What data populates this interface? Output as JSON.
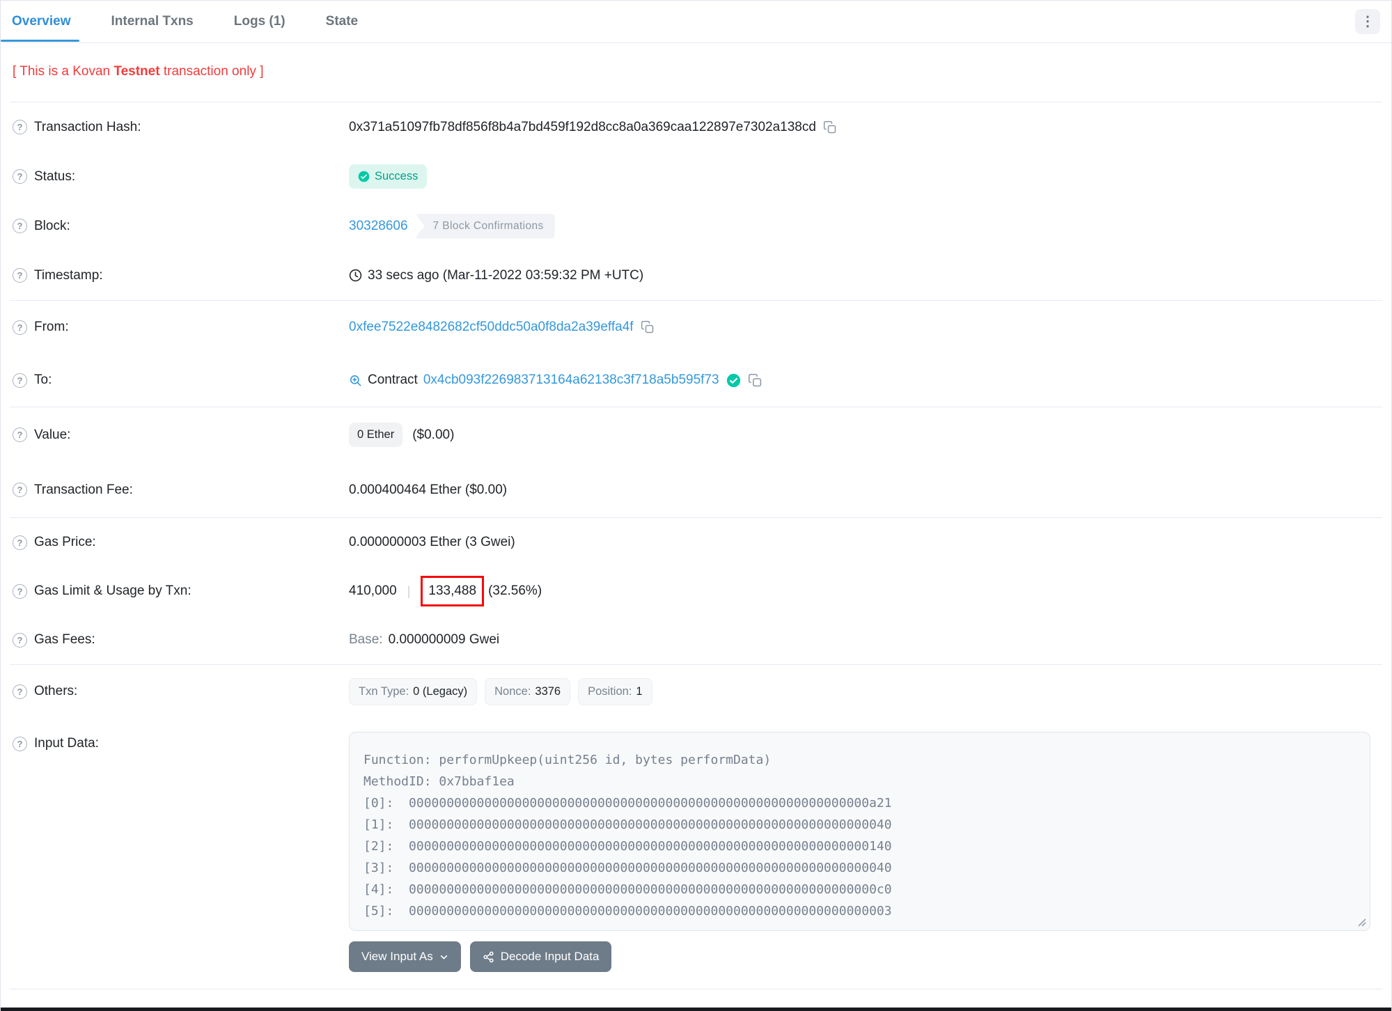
{
  "tabs": [
    {
      "label": "Overview",
      "active": true
    },
    {
      "label": "Internal Txns",
      "active": false
    },
    {
      "label": "Logs (1)",
      "active": false
    },
    {
      "label": "State",
      "active": false
    }
  ],
  "warning": {
    "prefix": "[ This is a Kovan ",
    "bold": "Testnet",
    "suffix": " transaction only ]"
  },
  "rows": {
    "transaction_hash": {
      "label": "Transaction Hash:",
      "value": "0x371a51097fb78df856f8b4a7bd459f192d8cc8a0a369caa122897e7302a138cd"
    },
    "status": {
      "label": "Status:",
      "value": "Success"
    },
    "block": {
      "label": "Block:",
      "number": "30328606",
      "confirmations": "7 Block Confirmations"
    },
    "timestamp": {
      "label": "Timestamp:",
      "value": "33 secs ago (Mar-11-2022 03:59:32 PM +UTC)"
    },
    "from": {
      "label": "From:",
      "address": "0xfee7522e8482682cf50ddc50a0f8da2a39effa4f"
    },
    "to": {
      "label": "To:",
      "contract_word": "Contract",
      "address": "0x4cb093f226983713164a62138c3f718a5b595f73"
    },
    "value": {
      "label": "Value:",
      "badge": "0 Ether",
      "usd": "($0.00)"
    },
    "transaction_fee": {
      "label": "Transaction Fee:",
      "value": "0.000400464 Ether ($0.00)"
    },
    "gas_price": {
      "label": "Gas Price:",
      "value": "0.000000003 Ether (3 Gwei)"
    },
    "gas_limit_usage": {
      "label": "Gas Limit & Usage by Txn:",
      "limit": "410,000",
      "separator": "|",
      "used": "133,488",
      "percent": "(32.56%)"
    },
    "gas_fees": {
      "label": "Gas Fees:",
      "base_label": "Base:",
      "base_value": "0.000000009 Gwei"
    },
    "others": {
      "label": "Others:",
      "badges": [
        {
          "k": "Txn Type:",
          "v": "0 (Legacy)"
        },
        {
          "k": "Nonce:",
          "v": "3376"
        },
        {
          "k": "Position:",
          "v": "1"
        }
      ]
    },
    "input_data": {
      "label": "Input Data:",
      "lines": [
        "Function: performUpkeep(uint256 id, bytes performData)",
        "",
        "MethodID: 0x7bbaf1ea",
        "[0]:  0000000000000000000000000000000000000000000000000000000000000a21",
        "[1]:  0000000000000000000000000000000000000000000000000000000000000040",
        "[2]:  0000000000000000000000000000000000000000000000000000000000000140",
        "[3]:  0000000000000000000000000000000000000000000000000000000000000040",
        "[4]:  00000000000000000000000000000000000000000000000000000000000000c0",
        "[5]:  0000000000000000000000000000000000000000000000000000000000000003"
      ]
    }
  },
  "input_actions": {
    "view_input_as": "View Input As",
    "decode_input_data": "Decode Input Data"
  },
  "icons": {
    "help_glyph": "?",
    "kebab_glyph": "⋮",
    "names": [
      "question-circle",
      "vertical-ellipsis",
      "copy",
      "check-circle",
      "clock",
      "zoom-in",
      "chevron-down",
      "decode-molecule",
      "resize-handle"
    ]
  },
  "colors": {
    "accent_blue": "#3498db",
    "success_teal": "#00c9a7",
    "success_bg": "#dcf6ef",
    "warning_red": "#f23b3b",
    "annotation_red": "#f40b0b",
    "muted_gray": "#77838f",
    "text_dark": "#212529",
    "button_slate": "#6e7b88"
  }
}
